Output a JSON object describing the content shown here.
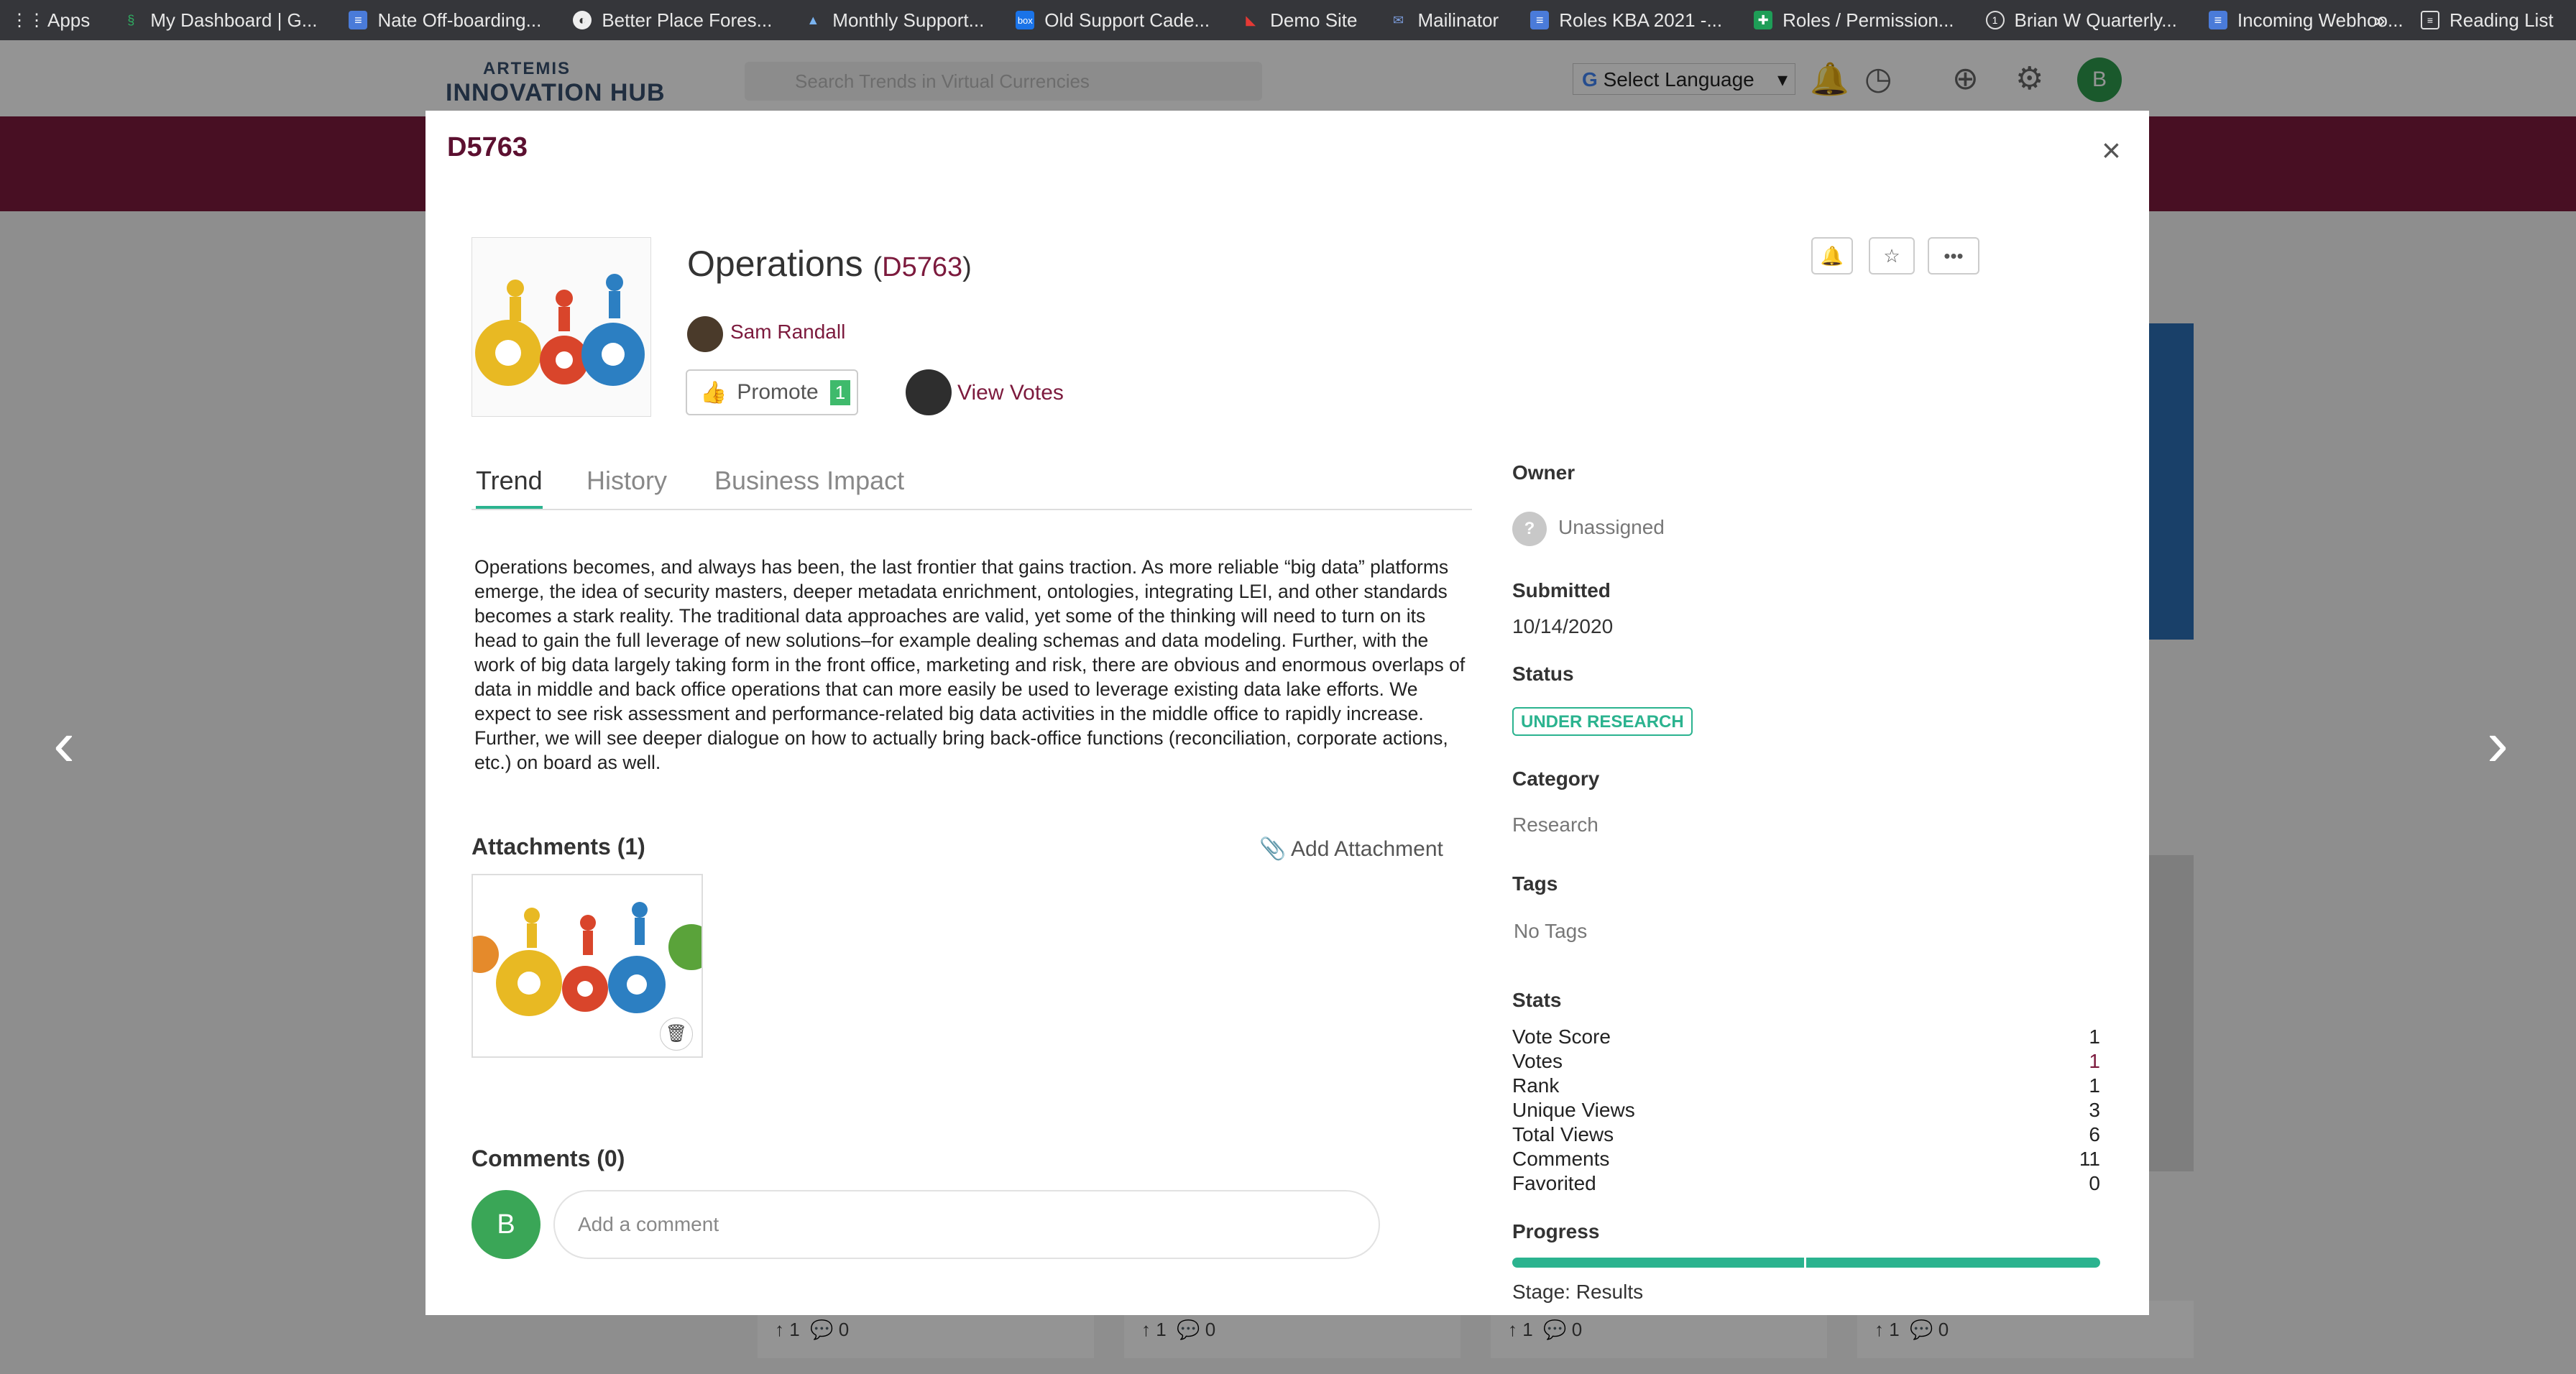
{
  "bookmarks": [
    {
      "label": "Apps",
      "icon": "apps-grid-icon"
    },
    {
      "label": "My Dashboard | G...",
      "icon": "dashboard-icon"
    },
    {
      "label": "Nate Off-boarding...",
      "icon": "doc-icon"
    },
    {
      "label": "Better Place Fores...",
      "icon": "globe-icon"
    },
    {
      "label": "Monthly Support...",
      "icon": "drive-icon"
    },
    {
      "label": "Old Support Cade...",
      "icon": "box-icon"
    },
    {
      "label": "Demo Site",
      "icon": "demo-icon"
    },
    {
      "label": "Mailinator",
      "icon": "mail-icon"
    },
    {
      "label": "Roles KBA 2021 -...",
      "icon": "doc-icon"
    },
    {
      "label": "Roles / Permission...",
      "icon": "sheet-icon"
    },
    {
      "label": "Brian W Quarterly...",
      "icon": "clock-icon"
    },
    {
      "label": "Incoming Webhoo...",
      "icon": "doc-icon"
    }
  ],
  "bookmarks_more": "»",
  "reading_list": "Reading List",
  "app": {
    "logo_line1": "ARTEMIS",
    "logo_line2": "INNOVATION HUB",
    "search_placeholder": "Search Trends in Virtual Currencies",
    "select_language": "Select Language",
    "user_initial": "B"
  },
  "background": {
    "card_footers": [
      {
        "votes": "1",
        "comments": "0"
      },
      {
        "votes": "1",
        "comments": "0"
      },
      {
        "votes": "1",
        "comments": "0"
      },
      {
        "votes": "1",
        "comments": "0"
      }
    ]
  },
  "modal": {
    "header_title": "D5763",
    "close": "×",
    "title": "Operations",
    "id_open": "(",
    "id": "D5763",
    "id_close": ")",
    "author": "Sam Randall",
    "promote_label": "Promote",
    "promote_count": "1",
    "view_votes": "View Votes",
    "tabs": [
      "Trend",
      "History",
      "Business Impact"
    ],
    "description": "Operations becomes, and always has been, the last frontier that gains traction. As more reliable “big data” platforms emerge, the idea of security masters, deeper metadata enrichment, ontologies, integrating LEI, and other standards becomes a stark reality. The traditional data approaches are valid, yet some of the thinking will need to turn on its head to gain the full leverage of new solutions–for example dealing schemas and data modeling. Further, with the work of big data largely taking form in the front office, marketing and risk, there are obvious and enormous overlaps of data in middle and back office operations that can more easily be used to leverage existing data lake efforts. We expect to see risk assessment and performance-related big data activities in the middle office to rapidly increase. Further, we will see deeper dialogue on how to actually bring back-office functions (reconciliation, corporate actions, etc.) on board as well.",
    "attachments_heading": "Attachments (1)",
    "add_attachment": "Add Attachment",
    "comments_heading": "Comments (0)",
    "comment_avatar": "B",
    "comment_placeholder": "Add a comment",
    "sidebar": {
      "owner_label": "Owner",
      "owner_value": "Unassigned",
      "submitted_label": "Submitted",
      "submitted_value": "10/14/2020",
      "status_label": "Status",
      "status_value": "UNDER RESEARCH",
      "category_label": "Category",
      "category_value": "Research",
      "tags_label": "Tags",
      "tags_value": "No Tags",
      "stats_label": "Stats",
      "stats": [
        {
          "label": "Vote Score",
          "value": "1"
        },
        {
          "label": "Votes",
          "value": "1"
        },
        {
          "label": "Rank",
          "value": "1"
        },
        {
          "label": "Unique Views",
          "value": "3"
        },
        {
          "label": "Total Views",
          "value": "6"
        },
        {
          "label": "Comments",
          "value": "11"
        },
        {
          "label": "Favorited",
          "value": "0"
        }
      ],
      "progress_label": "Progress",
      "progress_fraction": 1.0,
      "stage": "Stage: Results"
    }
  },
  "colors": {
    "brand": "#7c1a3d",
    "accent": "#2bb38f",
    "promote_badge": "#3fba6c"
  }
}
